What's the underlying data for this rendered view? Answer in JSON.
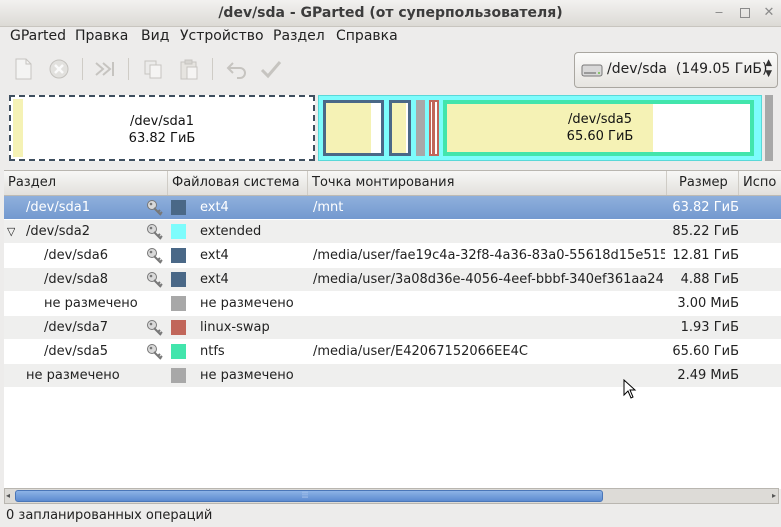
{
  "window": {
    "title": "/dev/sda - GParted (от суперпользователя)",
    "minimize": "‒",
    "close": "✕"
  },
  "menu": [
    "GParted",
    "Правка",
    "Вид",
    "Устройство",
    "Раздел",
    "Справка"
  ],
  "toolbar": {
    "icons": [
      "new-icon",
      "delete-icon",
      "resize-move-icon",
      "copy-icon",
      "paste-icon",
      "undo-icon",
      "apply-icon"
    ]
  },
  "device_selector": {
    "label": "/dev/sda  (149.05 ГиБ)",
    "up": "▲",
    "down": "▼"
  },
  "diskmap": {
    "sda1": {
      "name": "/dev/sda1",
      "size": "63.82 ГиБ"
    },
    "sda5": {
      "name": "/dev/sda5",
      "size": "65.60 ГиБ"
    }
  },
  "table": {
    "columns": [
      "Раздел",
      "Файловая система",
      "Точка монтирования",
      "Размер",
      "Испо"
    ],
    "rows": [
      {
        "partition": "/dev/sda1",
        "fs": "ext4",
        "mount": "/mnt",
        "size": "63.82 ГиБ",
        "color": "#4a6887",
        "key": true,
        "indent": 1,
        "selected": true
      },
      {
        "partition": "/dev/sda2",
        "fs": "extended",
        "mount": "",
        "size": "85.22 ГиБ",
        "color": "#7dfcfc",
        "key": true,
        "indent": 1,
        "expander": "▽"
      },
      {
        "partition": "/dev/sda6",
        "fs": "ext4",
        "mount": "/media/user/fae19c4a-32f8-4a36-83a0-55618d15e515",
        "size": "12.81 ГиБ",
        "color": "#4a6887",
        "key": true,
        "indent": 2
      },
      {
        "partition": "/dev/sda8",
        "fs": "ext4",
        "mount": "/media/user/3a08d36e-4056-4eef-bbbf-340ef361aa24",
        "size": "4.88 ГиБ",
        "color": "#4a6887",
        "key": true,
        "indent": 2
      },
      {
        "partition": "не размечено",
        "fs": "не размечено",
        "mount": "",
        "size": "3.00 МиБ",
        "color": "#a8a8a8",
        "key": false,
        "indent": 2
      },
      {
        "partition": "/dev/sda7",
        "fs": "linux-swap",
        "mount": "",
        "size": "1.93 ГиБ",
        "color": "#c1665a",
        "key": true,
        "indent": 2
      },
      {
        "partition": "/dev/sda5",
        "fs": "ntfs",
        "mount": "/media/user/E42067152066EE4C",
        "size": "65.60 ГиБ",
        "color": "#42e5ac",
        "key": true,
        "indent": 2
      },
      {
        "partition": "не размечено",
        "fs": "не размечено",
        "mount": "",
        "size": "2.49 МиБ",
        "color": "#a8a8a8",
        "key": false,
        "indent": 1
      }
    ]
  },
  "status": "0 запланированных операций"
}
